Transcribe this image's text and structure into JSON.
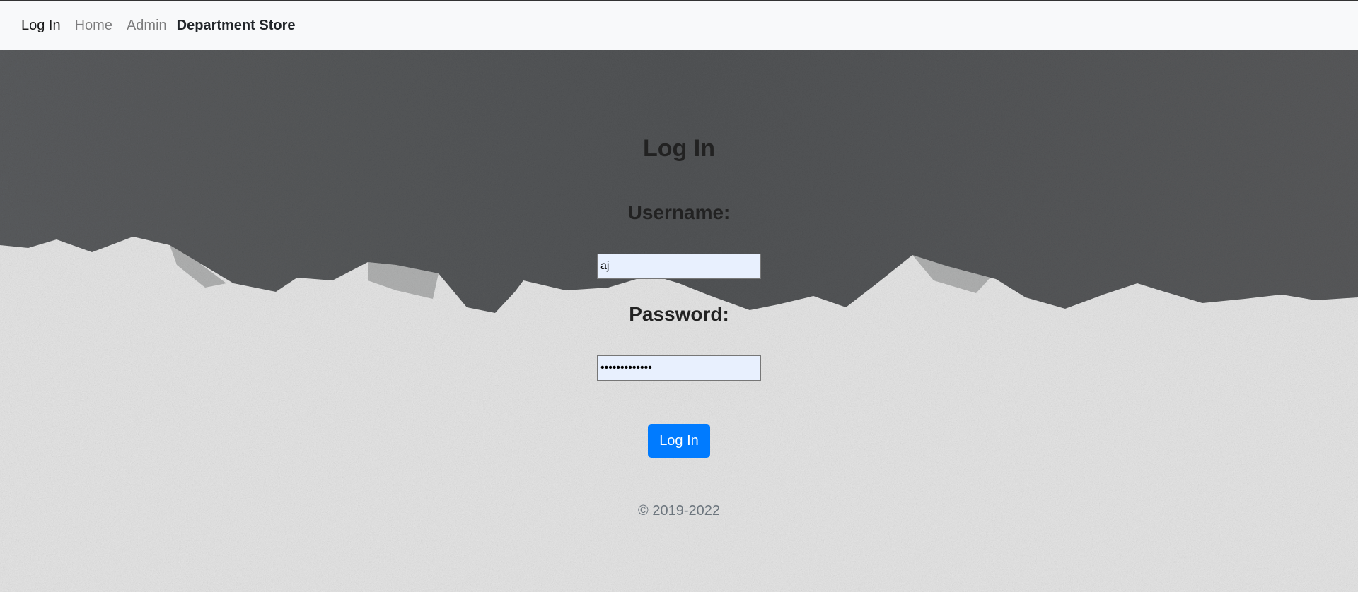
{
  "nav": {
    "login_label": "Log In",
    "home_label": "Home",
    "admin_label": "Admin",
    "brand": "Department Store"
  },
  "form": {
    "title": "Log In",
    "username_label": "Username:",
    "username_value": "aj",
    "password_label": "Password:",
    "password_value": "•••••••••••••",
    "submit_label": "Log In"
  },
  "footer": {
    "copyright": "© 2019-2022"
  },
  "colors": {
    "navbar_bg": "#f8f9fa",
    "button_bg": "#007bff",
    "input_bg": "#e8f0fe",
    "wall_dark": "#555759",
    "wall_light": "#e9e9e9"
  }
}
